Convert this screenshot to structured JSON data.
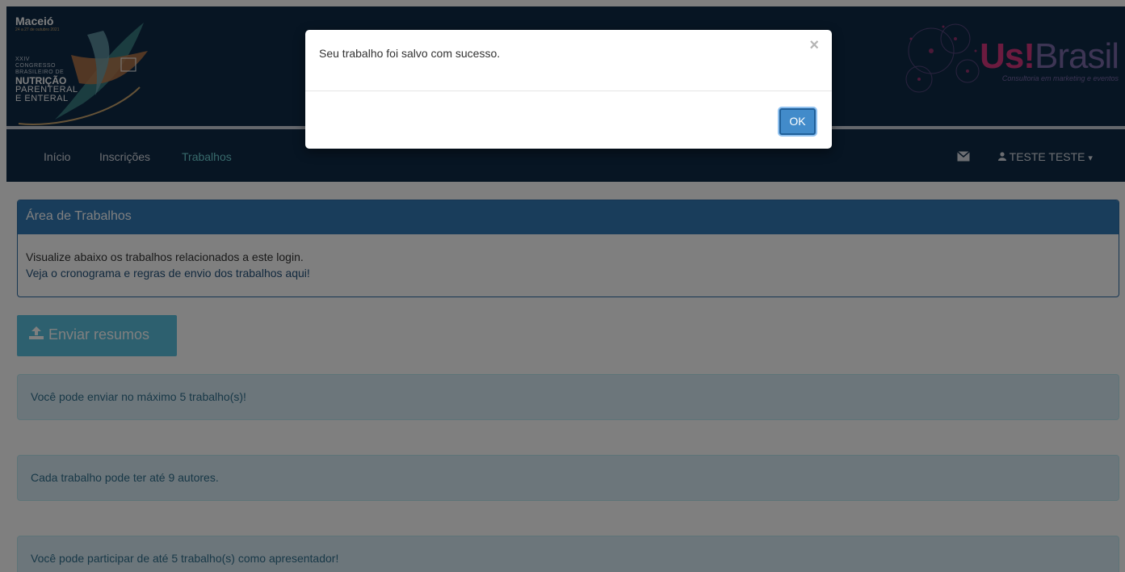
{
  "header": {
    "left_logo": {
      "city": "Maceió",
      "date": "24 a 27 de outubro 2021",
      "congress_lines": [
        "XXIV",
        "CONGRESSO",
        "BRASILEIRO DE"
      ],
      "nutricao": "NUTRIÇÃO",
      "parenteral": "PARENTERAL",
      "enteral": "E ENTERAL"
    },
    "right_logo": {
      "brand_us": "Us!",
      "brand_brasil": "Brasil",
      "tagline": "Consultoria em marketing e eventos"
    }
  },
  "nav": {
    "items": [
      {
        "label": "Início",
        "active": false
      },
      {
        "label": "Inscrições",
        "active": false
      },
      {
        "label": "Trabalhos",
        "active": true
      }
    ],
    "mail_icon": "envelope-icon",
    "user_icon": "user-icon",
    "user_label": "TESTE TESTE",
    "caret": "▾"
  },
  "panel": {
    "title": "Área de Trabalhos",
    "line1": "Visualize abaixo os trabalhos relacionados a este login.",
    "line2": "Veja o cronograma e regras de envio dos trabalhos aqui!"
  },
  "send_button": {
    "icon": "upload-icon",
    "label": "Enviar resumos"
  },
  "alerts": [
    "Você pode enviar no máximo 5 trabalho(s)!",
    "Cada trabalho pode ter até 9 autores.",
    "Você pode participar de até 5 trabalho(s) como apresentador!"
  ],
  "modal": {
    "message": "Seu trabalho foi salvo com sucesso.",
    "close_symbol": "×",
    "ok_label": "OK"
  },
  "colors": {
    "header_bg": "#0f2a47",
    "nav_active": "#6fd3d6",
    "panel_primary": "#337ab7",
    "btn_info": "#5bc0de",
    "alert_info_bg": "#d9edf7",
    "ok_button": "#428bca"
  }
}
